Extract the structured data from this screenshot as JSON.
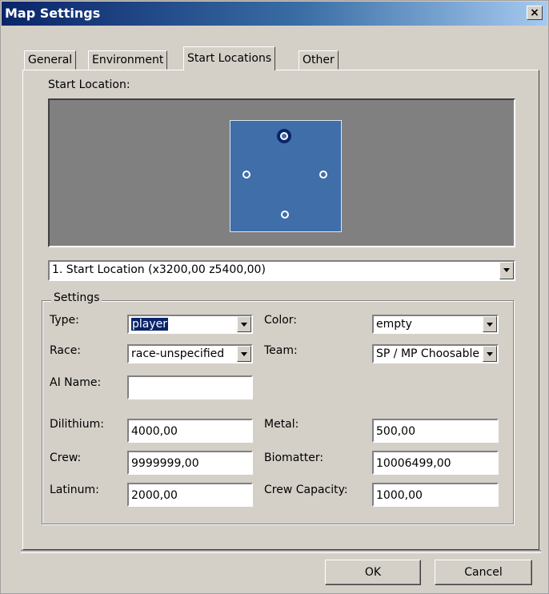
{
  "window": {
    "title": "Map Settings",
    "close_glyph": "×"
  },
  "tabs": [
    {
      "label": "General"
    },
    {
      "label": "Environment"
    },
    {
      "label": "Start Locations"
    },
    {
      "label": "Other"
    }
  ],
  "start_location": {
    "label": "Start Location:",
    "selected": "1. Start Location (x3200,00 z5400,00)"
  },
  "settings": {
    "group_label": "Settings",
    "type": {
      "label": "Type:",
      "value": "player"
    },
    "color": {
      "label": "Color:",
      "value": "empty"
    },
    "race": {
      "label": "Race:",
      "value": "race-unspecified"
    },
    "team": {
      "label": "Team:",
      "value": "SP / MP Choosable"
    },
    "ai_name": {
      "label": "AI Name:",
      "value": ""
    },
    "dilithium": {
      "label": "Dilithium:",
      "value": "4000,00"
    },
    "metal": {
      "label": "Metal:",
      "value": "500,00"
    },
    "crew": {
      "label": "Crew:",
      "value": "9999999,00"
    },
    "biomatter": {
      "label": "Biomatter:",
      "value": "10006499,00"
    },
    "latinum": {
      "label": "Latinum:",
      "value": "2000,00"
    },
    "crew_capacity": {
      "label": "Crew Capacity:",
      "value": "1000,00"
    }
  },
  "buttons": {
    "ok": "OK",
    "cancel": "Cancel"
  },
  "colors": {
    "title_start": "#0a246a",
    "map_blue": "#3f6ea9",
    "dialog_face": "#d4d0c8"
  }
}
